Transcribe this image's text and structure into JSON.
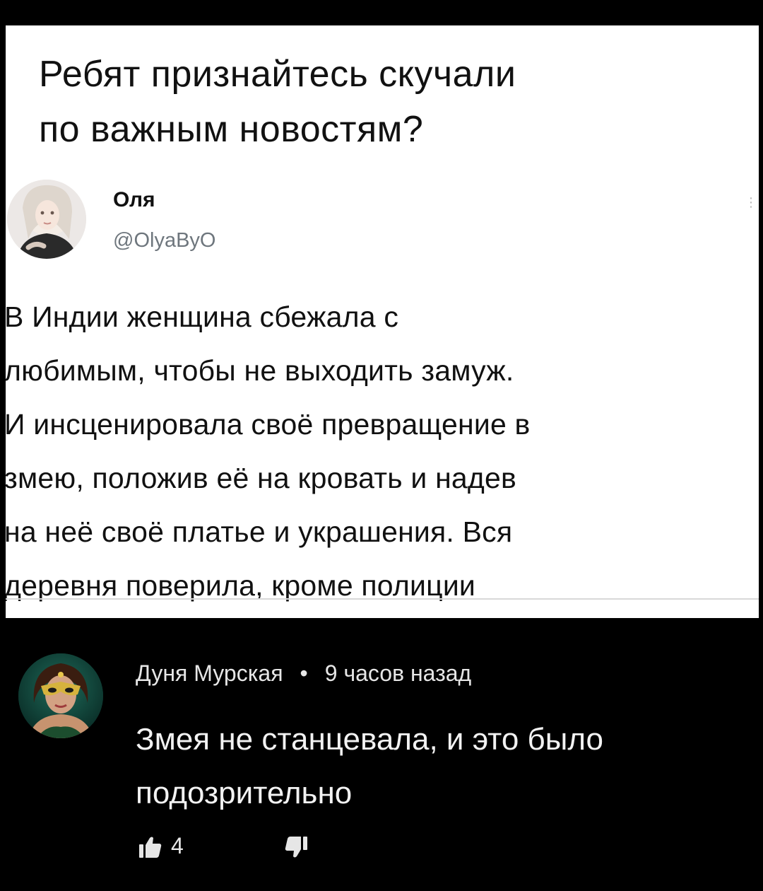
{
  "meme": {
    "caption_lines": [
      "Ребят признайтесь скучали",
      "по важным новостям?"
    ],
    "tweet": {
      "name": "Оля",
      "handle": "@OlyaByO",
      "text_lines": [
        "В Индии женщина сбежала с",
        "любимым, чтобы не выходить замуж.",
        "И инсценировала своё превращение в",
        "змею, положив её на кровать и надев",
        "на неё своё платье и украшения. Вся",
        "деревня поверила, кроме полиции"
      ],
      "more_glyph": "⋮"
    }
  },
  "comment": {
    "author": "Дуня Мурская",
    "separator": "•",
    "time": "9 часов назад",
    "text_lines": [
      "Змея не станцевала, и это было",
      "подозрительно"
    ],
    "likes": "4"
  },
  "icons": {
    "like": "thumbs-up-icon",
    "dislike": "thumbs-down-icon"
  },
  "colors": {
    "page_background": "#000000",
    "card_background": "#ffffff",
    "handle_gray": "#6e767d",
    "comment_text": "#f2f2f2"
  }
}
